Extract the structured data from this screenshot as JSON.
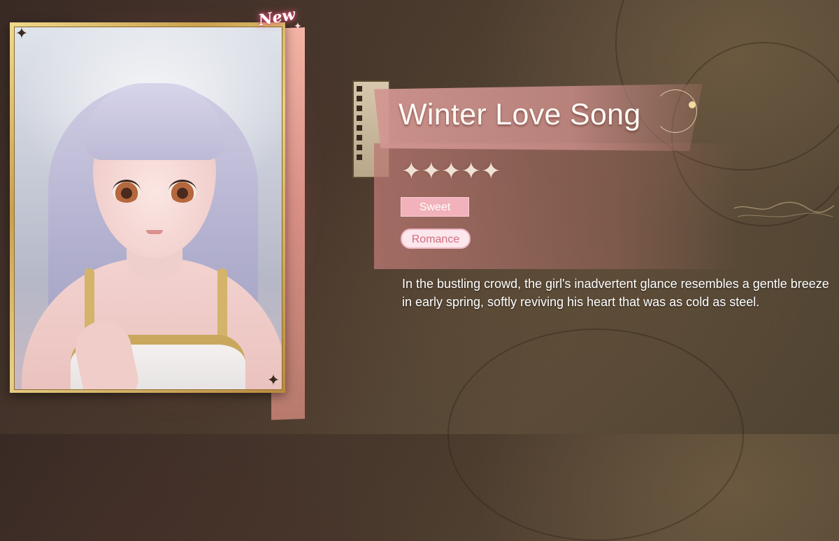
{
  "card": {
    "badge": "New",
    "icons": [
      "corner-ornament-icon",
      "sparkle-icon"
    ]
  },
  "outfit": {
    "title": "Winter Love Song",
    "rarity_stars": 5,
    "tags": [
      "Sweet",
      "Romance"
    ],
    "description": "In the bustling crowd, the girl's inadvertent glance resembles a gentle breeze in early spring, softly reviving his heart that was as cold as steel."
  },
  "colors": {
    "tag_sweet_bg": "#f2b2bb",
    "tag_romance_text": "#d36d84",
    "frame_gold": "#c9a14f",
    "title_panel_pink": "#d29691"
  }
}
